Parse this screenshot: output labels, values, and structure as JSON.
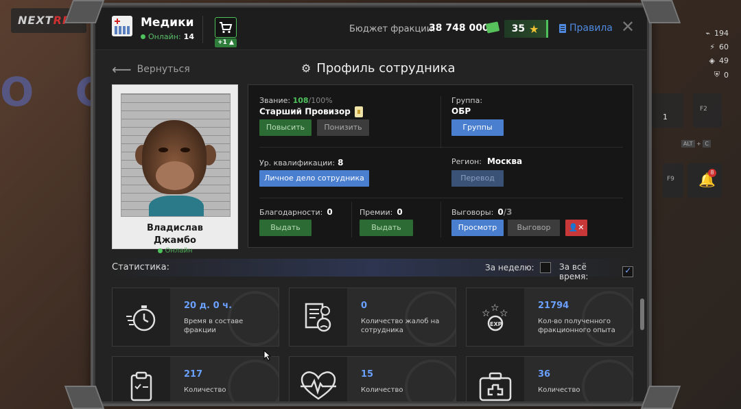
{
  "background": {
    "logo_left": "NEXT",
    "logo_right": "RP",
    "hud_stats": [
      "194",
      "60",
      "49",
      "0"
    ],
    "hud_counter": "1",
    "hud_keys": [
      "ALT",
      "C",
      "F2",
      "F9"
    ],
    "hud_badge": "8"
  },
  "header": {
    "faction_name": "Медики",
    "online_label": "Онлайн:",
    "online_count": "14",
    "cart_badge": "+1",
    "budget_label": "Бюджет фракции:",
    "budget_value": "38 748 000",
    "stars_value": "35",
    "rules_label": "Правила",
    "close_symbol": "✕"
  },
  "nav": {
    "back_label": "Вернуться",
    "page_title": "Профиль сотрудника"
  },
  "employee": {
    "first_name": "Владислав",
    "last_name": "Джамбо",
    "status": "Онлайн"
  },
  "info": {
    "rank_label": "Звание:",
    "rank_progress": "108",
    "rank_max": "/100%",
    "rank_name": "Старший Провизор",
    "promote_btn": "Повысить",
    "demote_btn": "Понизить",
    "group_label": "Группа:",
    "group_value": "ОБР",
    "groups_btn": "Группы",
    "qualification_label": "Ур. квалификации:",
    "qualification_value": "8",
    "personal_file_btn": "Личное дело сотрудника",
    "region_label": "Регион:",
    "region_value": "Москва",
    "transfer_btn": "Перевод",
    "thanks_label": "Благодарности:",
    "thanks_value": "0",
    "thanks_btn": "Выдать",
    "bonus_label": "Премии:",
    "bonus_value": "0",
    "bonus_btn": "Выдать",
    "reprimand_label": "Выговоры:",
    "reprimand_value": "0",
    "reprimand_max": "/3",
    "view_btn": "Просмотр",
    "reprimand_btn": "Выговор"
  },
  "stats": {
    "title": "Статистика:",
    "week_label": "За неделю:",
    "alltime_label": "За всё время:",
    "cards": [
      {
        "value": "20 д. 0 ч.",
        "desc": "Время в составе фракции",
        "icon": "stopwatch-icon"
      },
      {
        "value": "0",
        "desc": "Количество жалоб на сотрудника",
        "icon": "complaint-icon"
      },
      {
        "value": "21794",
        "desc": "Кол-во полученного фракционного опыта",
        "icon": "exp-icon"
      },
      {
        "value": "217",
        "desc": "Количество",
        "icon": "clipboard-icon"
      },
      {
        "value": "15",
        "desc": "Количество",
        "icon": "heartbeat-icon"
      },
      {
        "value": "36",
        "desc": "Количество",
        "icon": "medkit-icon"
      }
    ]
  },
  "colors": {
    "accent_blue": "#4a7fd0",
    "accent_green": "#4ec25c",
    "danger_red": "#c83838",
    "panel_bg": "#232323"
  }
}
